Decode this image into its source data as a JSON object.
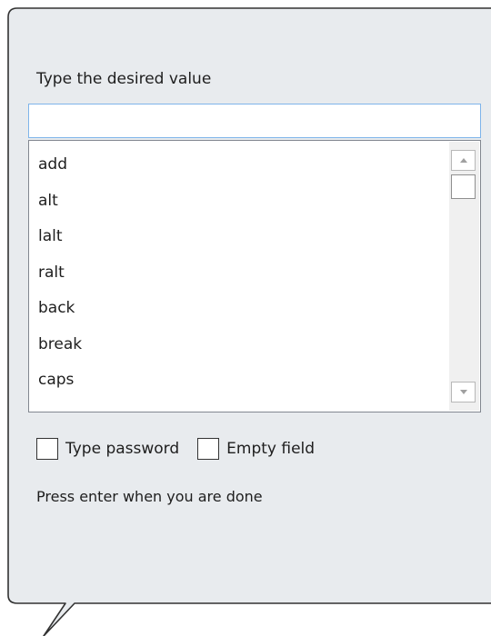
{
  "prompt": {
    "label": "Type the desired value",
    "value": "",
    "placeholder": ""
  },
  "list": {
    "items": [
      "add",
      "alt",
      "lalt",
      "ralt",
      "back",
      "break",
      "caps"
    ]
  },
  "options": {
    "type_password": {
      "label": "Type password",
      "checked": false
    },
    "empty_field": {
      "label": "Empty field",
      "checked": false
    }
  },
  "hint": "Press enter when you are done",
  "colors": {
    "panel_background": "#e8ebee",
    "panel_border": "#323232",
    "input_focus_border": "#7eb4ea",
    "list_border": "#828790"
  }
}
